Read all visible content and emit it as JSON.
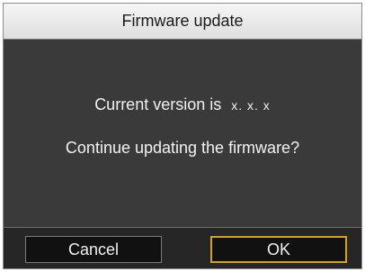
{
  "dialog": {
    "title": "Firmware update",
    "message": {
      "version_prefix": "Current version is",
      "version_value": "x. x. x",
      "question": "Continue updating the firmware?"
    },
    "buttons": {
      "cancel_label": "Cancel",
      "ok_label": "OK"
    }
  },
  "colors": {
    "dialog_background": "#3a3a3a",
    "title_bar": "#e8e8e8",
    "footer_background": "#262626",
    "button_background": "#111111",
    "focus_border": "#d6a21c"
  }
}
